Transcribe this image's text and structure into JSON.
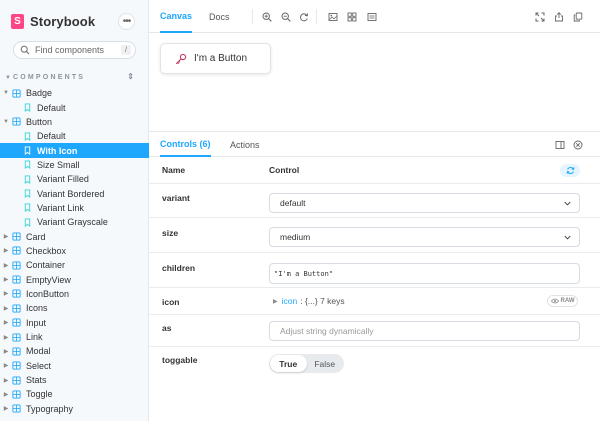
{
  "brand": {
    "name": "Storybook",
    "logo_letter": "S",
    "menu_glyph": "•••"
  },
  "search": {
    "placeholder": "Find components",
    "shortcut": "/"
  },
  "sidebar": {
    "section_title": "COMPONENTS",
    "tree": [
      {
        "label": "Badge",
        "level": 0,
        "expanded": true,
        "kind": "component"
      },
      {
        "label": "Default",
        "level": 1,
        "kind": "story"
      },
      {
        "label": "Button",
        "level": 0,
        "expanded": true,
        "kind": "component"
      },
      {
        "label": "Default",
        "level": 1,
        "kind": "story"
      },
      {
        "label": "With Icon",
        "level": 1,
        "kind": "story",
        "selected": true
      },
      {
        "label": "Size Small",
        "level": 1,
        "kind": "story"
      },
      {
        "label": "Variant Filled",
        "level": 1,
        "kind": "story"
      },
      {
        "label": "Variant Bordered",
        "level": 1,
        "kind": "story"
      },
      {
        "label": "Variant Link",
        "level": 1,
        "kind": "story"
      },
      {
        "label": "Variant Grayscale",
        "level": 1,
        "kind": "story"
      },
      {
        "label": "Card",
        "level": 0,
        "kind": "component"
      },
      {
        "label": "Checkbox",
        "level": 0,
        "kind": "component"
      },
      {
        "label": "Container",
        "level": 0,
        "kind": "component"
      },
      {
        "label": "EmptyView",
        "level": 0,
        "kind": "component"
      },
      {
        "label": "IconButton",
        "level": 0,
        "kind": "component"
      },
      {
        "label": "Icons",
        "level": 0,
        "kind": "component"
      },
      {
        "label": "Input",
        "level": 0,
        "kind": "component"
      },
      {
        "label": "Link",
        "level": 0,
        "kind": "component"
      },
      {
        "label": "Modal",
        "level": 0,
        "kind": "component"
      },
      {
        "label": "Select",
        "level": 0,
        "kind": "component"
      },
      {
        "label": "Stats",
        "level": 0,
        "kind": "component"
      },
      {
        "label": "Toggle",
        "level": 0,
        "kind": "component"
      },
      {
        "label": "Typography",
        "level": 0,
        "kind": "component"
      }
    ]
  },
  "toolbar": {
    "tabs": {
      "canvas": "Canvas",
      "docs": "Docs"
    },
    "icons": [
      "zoom-in-icon",
      "zoom-out-icon",
      "zoom-reset-icon",
      "background-icon",
      "grid-icon",
      "measure-icon",
      "fullscreen-icon",
      "share-icon",
      "copy-link-icon"
    ]
  },
  "preview": {
    "button_label": "I'm a Button"
  },
  "addons": {
    "tabs": {
      "controls": "Controls (6)",
      "actions": "Actions"
    },
    "table": {
      "header_name": "Name",
      "header_control": "Control",
      "variant": {
        "name": "variant",
        "value": "default"
      },
      "size": {
        "name": "size",
        "value": "medium"
      },
      "children": {
        "name": "children",
        "value": "\"I'm a Button\""
      },
      "icon": {
        "name": "icon",
        "key": "icon",
        "summary": ": {...} 7 keys",
        "raw_label": "RAW"
      },
      "as": {
        "name": "as",
        "placeholder": "Adjust string dynamically"
      },
      "toggable": {
        "name": "toggable",
        "true_label": "True",
        "false_label": "False",
        "selected": "True"
      }
    }
  },
  "colors": {
    "accent": "#1ea7fd",
    "brand": "#ff4785"
  }
}
